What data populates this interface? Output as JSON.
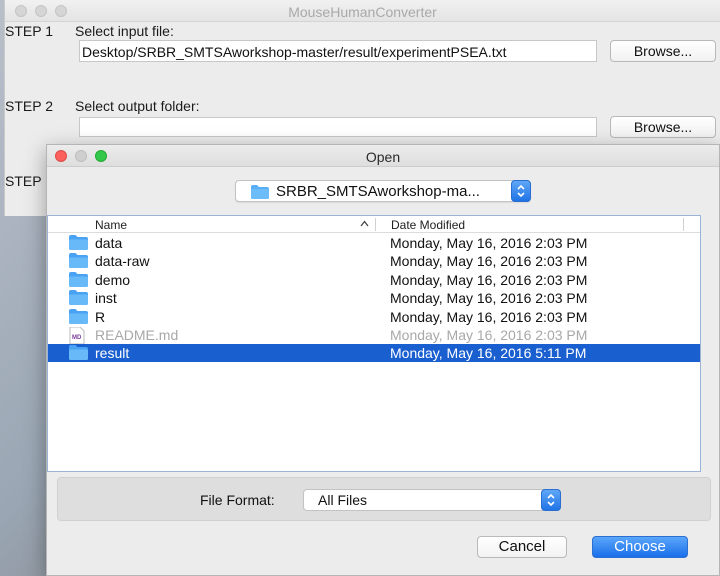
{
  "app": {
    "title": "MouseHumanConverter",
    "step1": {
      "label": "STEP 1",
      "prompt": "Select input file:",
      "value": "Desktop/SRBR_SMTSAworkshop-master/result/experimentPSEA.txt",
      "button": "Browse..."
    },
    "step2": {
      "label": "STEP 2",
      "prompt": "Select output folder:",
      "value": "",
      "button": "Browse..."
    },
    "step3": {
      "label": "STEP"
    }
  },
  "dialog": {
    "title": "Open",
    "location": "SRBR_SMTSAworkshop-ma...",
    "columns": {
      "name": "Name",
      "date": "Date Modified"
    },
    "files": [
      {
        "name": "data",
        "date": "Monday, May 16, 2016 2:03 PM",
        "icon": "folder-icon"
      },
      {
        "name": "data-raw",
        "date": "Monday, May 16, 2016 2:03 PM",
        "icon": "folder-icon"
      },
      {
        "name": "demo",
        "date": "Monday, May 16, 2016 2:03 PM",
        "icon": "folder-icon"
      },
      {
        "name": "inst",
        "date": "Monday, May 16, 2016 2:03 PM",
        "icon": "folder-icon"
      },
      {
        "name": "R",
        "date": "Monday, May 16, 2016 2:03 PM",
        "icon": "folder-icon"
      },
      {
        "name": "README.md",
        "date": "Monday, May 16, 2016 2:03 PM",
        "icon": "markdown-file-icon",
        "md_badge": "MD"
      },
      {
        "name": "result",
        "date": "Monday, May 16, 2016 5:11 PM",
        "icon": "folder-icon"
      }
    ],
    "file_format": {
      "label": "File Format:",
      "value": "All Files"
    },
    "buttons": {
      "cancel": "Cancel",
      "choose": "Choose"
    }
  },
  "colors": {
    "accent": "#1a5fd0",
    "folder": "#5aaef5",
    "close": "#fc605c",
    "zoom": "#34c84a"
  }
}
